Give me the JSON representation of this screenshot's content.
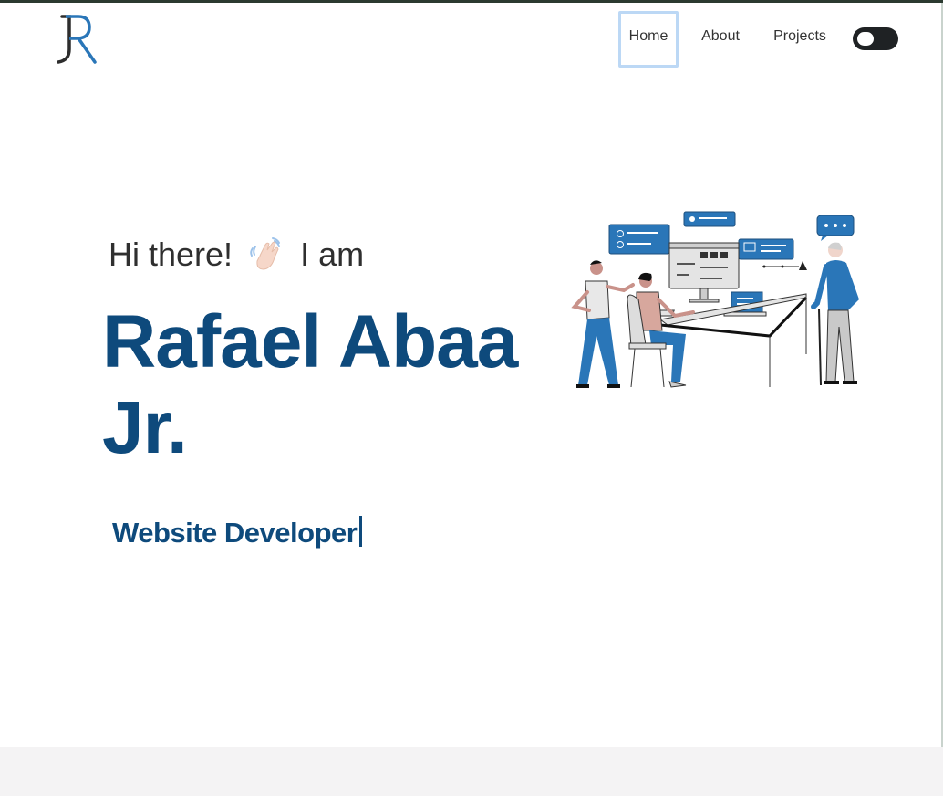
{
  "header": {
    "logo_text": "R",
    "nav": [
      {
        "label": "Home"
      },
      {
        "label": "About"
      },
      {
        "label": "Projects"
      }
    ]
  },
  "hero": {
    "greeting_before": "Hi there!",
    "greeting_icon": "waving-hand-icon",
    "greeting_after": "I am",
    "name": "Rafael Abaa Jr.",
    "role": "Website Developer"
  },
  "colors": {
    "brand": "#0e4a7c",
    "accent": "#2a76b8",
    "toggle": "#1f2224"
  }
}
